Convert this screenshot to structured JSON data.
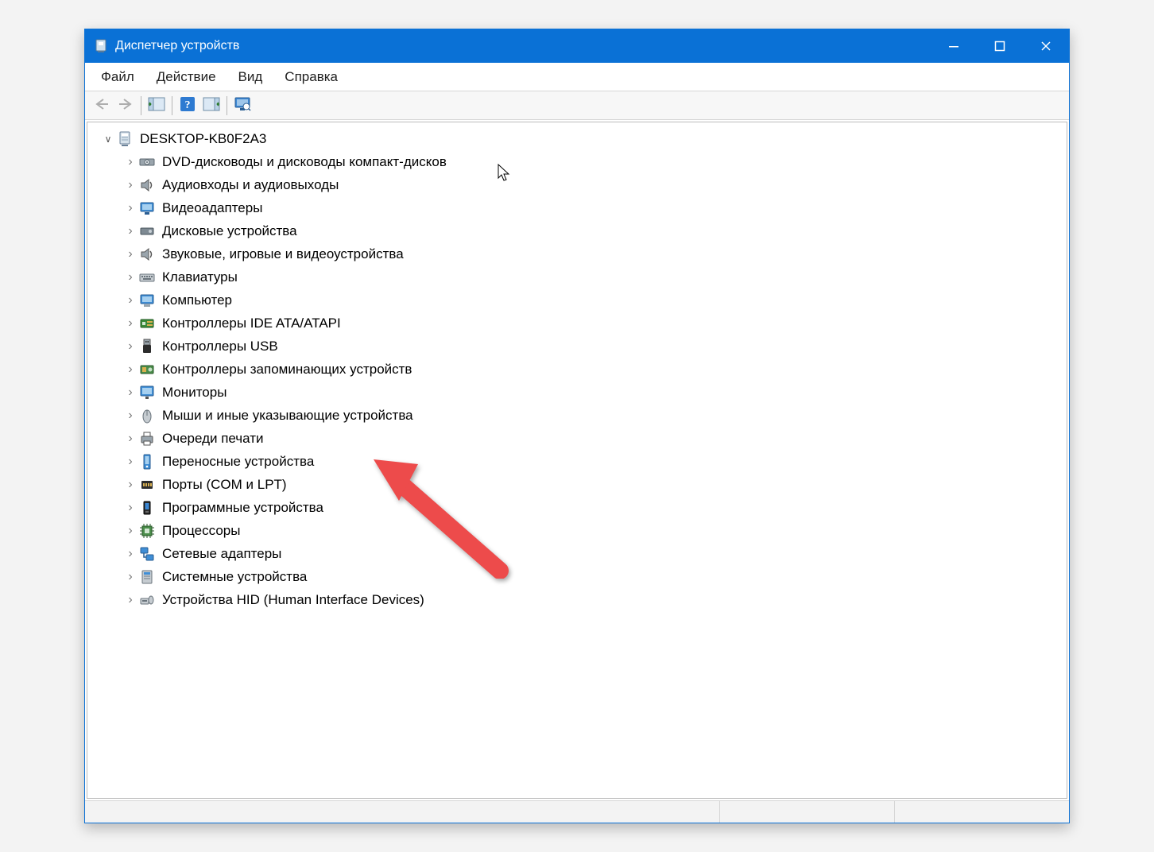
{
  "window": {
    "title": "Диспетчер устройств"
  },
  "menubar": {
    "file": "Файл",
    "action": "Действие",
    "view": "Вид",
    "help": "Справка"
  },
  "toolbar": {
    "back": "Назад",
    "forward": "Вперёд",
    "show_hidden": "Показать скрытые",
    "help": "Справка",
    "properties": "Свойства",
    "scan": "Обновить конфигурацию оборудования"
  },
  "tree": {
    "root": "DESKTOP-KB0F2A3",
    "items": [
      {
        "icon": "dvd",
        "label": "DVD-дисководы и дисководы компакт-дисков"
      },
      {
        "icon": "audio",
        "label": "Аудиовходы и аудиовыходы"
      },
      {
        "icon": "display",
        "label": "Видеоадаптеры"
      },
      {
        "icon": "disk",
        "label": "Дисковые устройства"
      },
      {
        "icon": "audio",
        "label": "Звуковые, игровые и видеоустройства"
      },
      {
        "icon": "keyboard",
        "label": "Клавиатуры"
      },
      {
        "icon": "computer",
        "label": "Компьютер"
      },
      {
        "icon": "ide",
        "label": "Контроллеры IDE ATA/ATAPI"
      },
      {
        "icon": "usb",
        "label": "Контроллеры USB"
      },
      {
        "icon": "storage",
        "label": "Контроллеры запоминающих устройств"
      },
      {
        "icon": "monitor",
        "label": "Мониторы"
      },
      {
        "icon": "mouse",
        "label": "Мыши и иные указывающие устройства"
      },
      {
        "icon": "printqueue",
        "label": "Очереди печати"
      },
      {
        "icon": "portable",
        "label": "Переносные устройства"
      },
      {
        "icon": "ports",
        "label": "Порты (COM и LPT)"
      },
      {
        "icon": "software",
        "label": "Программные устройства"
      },
      {
        "icon": "cpu",
        "label": "Процессоры"
      },
      {
        "icon": "network",
        "label": "Сетевые адаптеры"
      },
      {
        "icon": "system",
        "label": "Системные устройства"
      },
      {
        "icon": "hid",
        "label": "Устройства HID (Human Interface Devices)"
      }
    ]
  },
  "annotation": {
    "arrow_target_index": 13,
    "arrow_color": "#ed4b4b"
  }
}
